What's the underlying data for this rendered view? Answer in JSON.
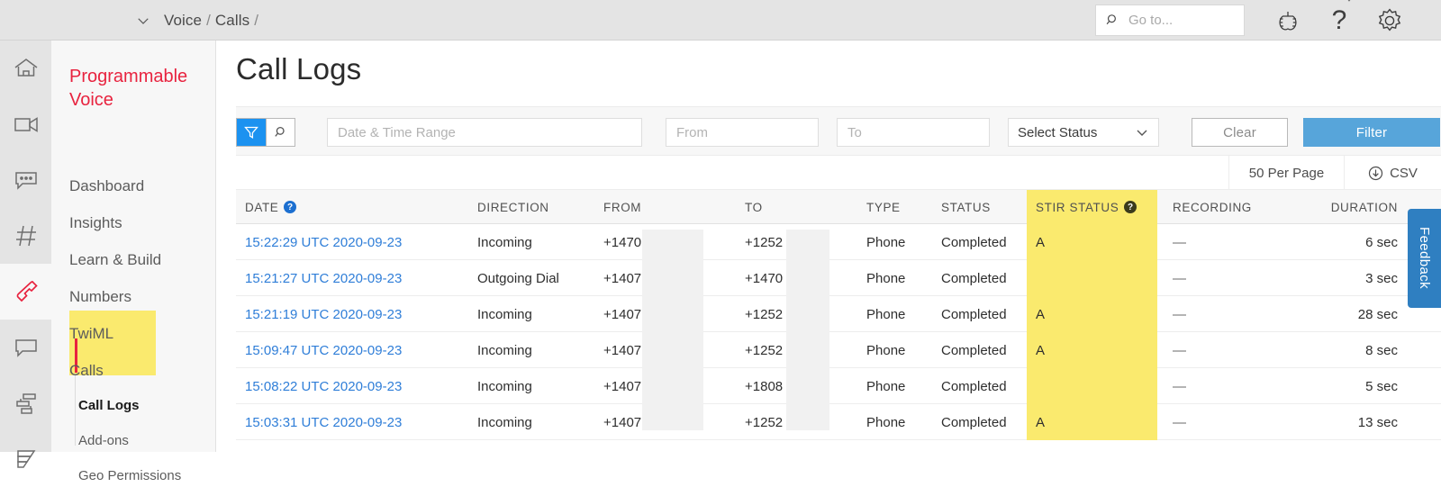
{
  "topbar": {
    "breadcrumb": [
      "Voice",
      "Calls"
    ],
    "breadcrumb_trailing_separator": "/",
    "search": {
      "placeholder": "Go to...",
      "value": ""
    },
    "icons": {
      "chevron": "chevron-down-icon",
      "search": "search-icon",
      "bug": "bug-icon",
      "help": "?",
      "gear": "gear-icon"
    }
  },
  "rail": {
    "items": [
      {
        "name": "home",
        "active": false
      },
      {
        "name": "video",
        "active": false
      },
      {
        "name": "messaging",
        "active": false
      },
      {
        "name": "channels",
        "active": false
      },
      {
        "name": "voice",
        "active": true
      },
      {
        "name": "chat",
        "active": false
      },
      {
        "name": "studio",
        "active": false
      },
      {
        "name": "stack",
        "active": false
      }
    ]
  },
  "sidebar": {
    "title": "Programmable Voice",
    "items": [
      {
        "label": "Dashboard",
        "sub": false,
        "highlight": false
      },
      {
        "label": "Insights",
        "sub": false,
        "highlight": false
      },
      {
        "label": "Learn & Build",
        "sub": false,
        "highlight": false
      },
      {
        "label": "Numbers",
        "sub": false,
        "highlight": false
      },
      {
        "label": "TwiML",
        "sub": false,
        "highlight": false
      },
      {
        "label": "Calls",
        "sub": false,
        "highlight": true
      },
      {
        "label": "Call Logs",
        "sub": true,
        "highlight": true
      },
      {
        "label": "Add-ons",
        "sub": true,
        "highlight": false
      },
      {
        "label": "Geo Permissions",
        "sub": true,
        "highlight": false
      }
    ]
  },
  "main": {
    "page_title": "Call Logs",
    "toolbar": {
      "filter_toggle_icon": "funnel-icon",
      "search_toggle_icon": "search-icon",
      "date_range_placeholder": "Date & Time Range",
      "date_range_value": "",
      "from_placeholder": "From",
      "from_value": "",
      "to_placeholder": "To",
      "to_value": "",
      "status_select_label": "Select Status",
      "clear_label": "Clear",
      "filter_label": "Filter"
    },
    "strip": {
      "per_page_label": "50 Per Page",
      "csv_label": "CSV",
      "csv_icon": "download-icon"
    },
    "table": {
      "columns": [
        {
          "key": "date",
          "label": "DATE",
          "help": true
        },
        {
          "key": "direction",
          "label": "DIRECTION",
          "help": false
        },
        {
          "key": "from",
          "label": "FROM",
          "help": false
        },
        {
          "key": "to",
          "label": "TO",
          "help": false
        },
        {
          "key": "type",
          "label": "TYPE",
          "help": false
        },
        {
          "key": "status",
          "label": "STATUS",
          "help": false
        },
        {
          "key": "stir",
          "label": "STIR STATUS",
          "help": true
        },
        {
          "key": "recording",
          "label": "RECORDING",
          "help": false
        },
        {
          "key": "duration",
          "label": "DURATION",
          "help": false
        }
      ],
      "rows": [
        {
          "date": "15:22:29 UTC 2020-09-23",
          "direction": "Incoming",
          "from": "+1470",
          "to": "+1252",
          "type": "Phone",
          "status": "Completed",
          "stir": "A",
          "recording": "—",
          "duration": "6 sec"
        },
        {
          "date": "15:21:27 UTC 2020-09-23",
          "direction": "Outgoing Dial",
          "from": "+1407",
          "to": "+1470",
          "type": "Phone",
          "status": "Completed",
          "stir": "",
          "recording": "—",
          "duration": "3 sec"
        },
        {
          "date": "15:21:19 UTC 2020-09-23",
          "direction": "Incoming",
          "from": "+1407",
          "to": "+1252",
          "type": "Phone",
          "status": "Completed",
          "stir": "A",
          "recording": "—",
          "duration": "28 sec"
        },
        {
          "date": "15:09:47 UTC 2020-09-23",
          "direction": "Incoming",
          "from": "+1407",
          "to": "+1252",
          "type": "Phone",
          "status": "Completed",
          "stir": "A",
          "recording": "—",
          "duration": "8 sec"
        },
        {
          "date": "15:08:22 UTC 2020-09-23",
          "direction": "Incoming",
          "from": "+1407",
          "to": "+1808",
          "type": "Phone",
          "status": "Completed",
          "stir": "",
          "recording": "—",
          "duration": "5 sec"
        },
        {
          "date": "15:03:31 UTC 2020-09-23",
          "direction": "Incoming",
          "from": "+1407",
          "to": "+1252",
          "type": "Phone",
          "status": "Completed",
          "stir": "A",
          "recording": "—",
          "duration": "13 sec"
        }
      ]
    }
  },
  "feedback": {
    "label": "Feedback"
  },
  "colors": {
    "accent_red": "#e8233f",
    "highlight_yellow": "#faea6e",
    "primary_blue": "#1c92f0",
    "filter_blue": "#57a5da",
    "link_blue": "#2f7ed8",
    "feedback_blue": "#2f7fc1"
  }
}
